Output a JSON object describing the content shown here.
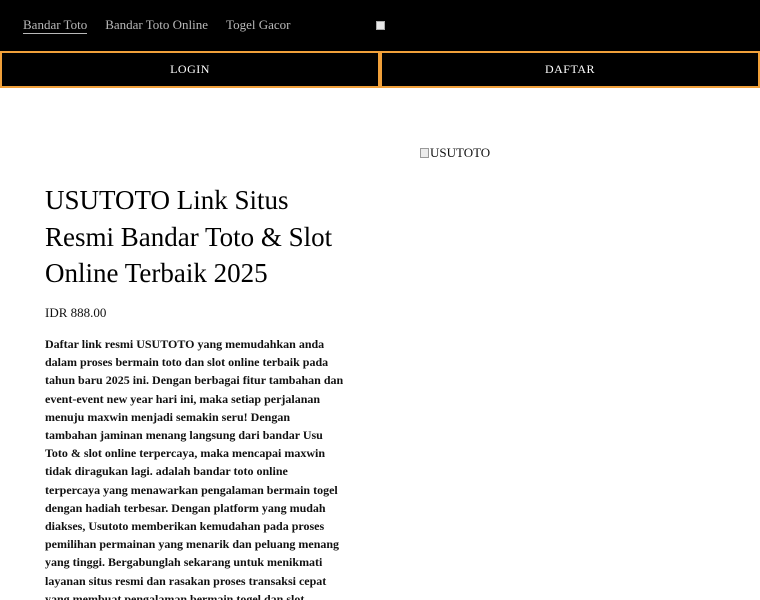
{
  "nav": {
    "items": [
      {
        "label": "Bandar Toto"
      },
      {
        "label": "Bandar Toto Online"
      },
      {
        "label": "Togel Gacor"
      }
    ]
  },
  "buttons": {
    "login_label": "LOGIN",
    "daftar_label": "DAFTAR"
  },
  "colors": {
    "accent_border": "#f0a03a",
    "header_bg": "#000000"
  },
  "hero": {
    "image_alt": "USUTOTO"
  },
  "product": {
    "title": "USUTOTO Link Situs Resmi Bandar Toto & Slot Online Terbaik 2025",
    "price": "IDR 888.00",
    "description": "Daftar link resmi USUTOTO yang memudahkan anda dalam proses bermain toto dan slot online terbaik pada tahun baru 2025 ini. Dengan berbagai fitur tambahan dan event-event new year hari ini, maka setiap perjalanan menuju maxwin menjadi semakin seru! Dengan tambahan jaminan menang langsung dari bandar Usu Toto & slot online terpercaya, maka mencapai maxwin tidak diragukan lagi. adalah bandar toto online terpercaya yang menawarkan pengalaman bermain togel dengan hadiah terbesar. Dengan platform yang mudah diakses, Usutoto memberikan kemudahan pada proses pemilihan permainan yang menarik dan peluang menang yang tinggi. Bergabunglah sekarang untuk menikmati layanan situs resmi dan rasakan proses transaksi cepat yang membuat pengalaman bermain togel dan slot semakin menyenangkan."
  }
}
